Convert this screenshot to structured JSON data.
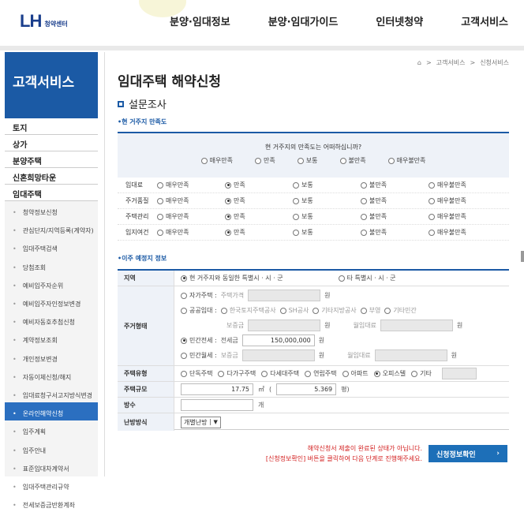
{
  "header": {
    "logo_mark": "LH",
    "logo_sub": "청약센터",
    "nav": [
      "분양·임대정보",
      "분양·임대가이드",
      "인터넷청약",
      "고객서비스"
    ]
  },
  "sidebar": {
    "title": "고객서비스",
    "main_items": [
      "토지",
      "상가",
      "분양주택",
      "신혼희망타운",
      "임대주택"
    ],
    "sub_items": [
      "청약정보신청",
      "관심단지/지역등록(계약자)",
      "임대주택검색",
      "당첨조회",
      "예비입주자순위",
      "예비입주자인정보변경",
      "예비자동호추첨신청",
      "계약정보조회",
      "개인정보변경",
      "자동이체신청/해지",
      "임대료청구서고지방식변경",
      "온라인해약신청",
      "입주계획",
      "입주안내",
      "표준임대차계약서",
      "임대주택관리규약",
      "전세보증금반환계좌"
    ],
    "active_sub": "온라인해약신청"
  },
  "breadcrumb": [
    "고객서비스",
    "신청서비스"
  ],
  "page_title": "임대주택 해약신청",
  "section_title": "설문조사",
  "survey": {
    "subtitle": "현 거주지 만족도",
    "question": "현 거주지의 만족도는 어떠하십니까?",
    "scale": [
      "매우만족",
      "만족",
      "보통",
      "불만족",
      "매우불만족"
    ],
    "rows": [
      {
        "label": "임대료",
        "selected": 1
      },
      {
        "label": "주거품질",
        "selected": 1
      },
      {
        "label": "주택관리",
        "selected": 1
      },
      {
        "label": "입지여건",
        "selected": 1
      }
    ]
  },
  "move": {
    "subtitle": "이주 예정지 정보",
    "region_label": "지역",
    "region_opt1": "현 거주지와 동일한 특별시 · 시 · 군",
    "region_opt2": "타 특별시 · 시 · 군",
    "housing_type_label": "주거형태",
    "own_label": "자가주택 :",
    "own_price_label": "주택가격",
    "unit_won": "원",
    "public_label": "공공임대 :",
    "public_opts": [
      "한국토지주택공사",
      "SH공사",
      "기타지방공사",
      "부영",
      "기타민간"
    ],
    "deposit_label": "보증금",
    "monthly_label": "월임대료",
    "private_jeonse_label": "민간전세 :",
    "jeonse_label": "전세금",
    "jeonse_value": "150,000,000",
    "private_monthly_label": "민간월세 :",
    "house_kind_label": "주택유형",
    "house_kinds": [
      "단독주택",
      "다가구주택",
      "다세대주택",
      "연립주택",
      "아파트",
      "오피스텔",
      "기타"
    ],
    "house_kind_selected": 5,
    "size_label": "주택규모",
    "size_m2": "17.75",
    "unit_m2": "㎡",
    "size_pyeong": "5.369",
    "unit_pyeong": "평)",
    "rooms_label": "방수",
    "unit_room": "개",
    "heating_label": "난방방식",
    "heating_value": "개별난방"
  },
  "notice": {
    "line1": "해약신청서 제출이 완료된 상태가 아닙니다.",
    "line2": "[신청정보확인] 버튼을 클릭하여 다음 단계로 진행해주세요."
  },
  "confirm_button": "신청정보확인",
  "colors": {
    "primary": "#1b5aa5",
    "button": "#1d6fb8",
    "notice": "#d32020"
  }
}
